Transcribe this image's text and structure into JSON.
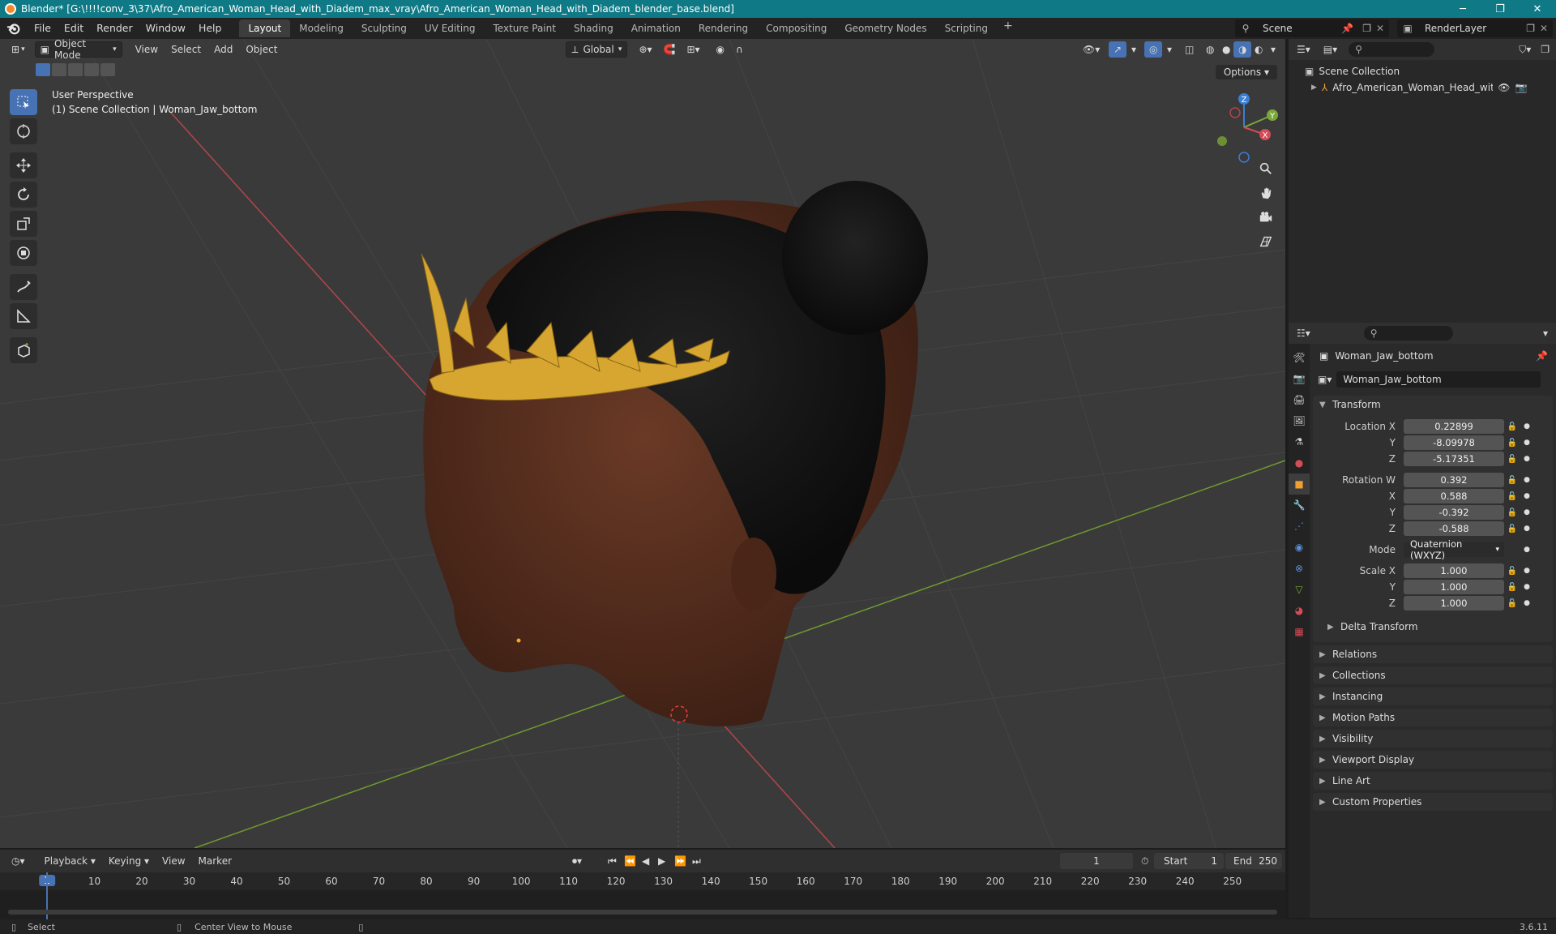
{
  "titlebar": {
    "title": "Blender* [G:\\!!!!conv_3\\37\\Afro_American_Woman_Head_with_Diadem_max_vray\\Afro_American_Woman_Head_with_Diadem_blender_base.blend]",
    "minimize": "─",
    "maximize": "❐",
    "close": "✕"
  },
  "menu": {
    "file": "File",
    "edit": "Edit",
    "render": "Render",
    "window": "Window",
    "help": "Help"
  },
  "workspaces": [
    "Layout",
    "Modeling",
    "Sculpting",
    "UV Editing",
    "Texture Paint",
    "Shading",
    "Animation",
    "Rendering",
    "Compositing",
    "Geometry Nodes",
    "Scripting"
  ],
  "workspace_add": "+",
  "scene": {
    "name": "Scene",
    "render_layer": "RenderLayer"
  },
  "viewport": {
    "mode": "Object Mode",
    "menus": {
      "view": "View",
      "select": "Select",
      "add": "Add",
      "object": "Object"
    },
    "transform_orientation": "Global",
    "options": "Options",
    "info_line1": "User Perspective",
    "info_line2": "(1) Scene Collection | Woman_Jaw_bottom",
    "gizmo": {
      "x": "X",
      "y": "Y",
      "z": "Z"
    }
  },
  "outliner": {
    "root": "Scene Collection",
    "items": [
      {
        "label": "Afro_American_Woman_Head_with_Dia"
      }
    ]
  },
  "properties": {
    "object_name": "Woman_Jaw_bottom",
    "data_name": "Woman_Jaw_bottom",
    "transform_title": "Transform",
    "location": {
      "label_x": "Location X",
      "label_y": "Y",
      "label_z": "Z",
      "x": "0.22899",
      "y": "-8.09978",
      "z": "-5.17351"
    },
    "rotation": {
      "label_w": "Rotation W",
      "label_x": "X",
      "label_y": "Y",
      "label_z": "Z",
      "w": "0.392",
      "x": "0.588",
      "y": "-0.392",
      "z": "-0.588"
    },
    "mode_label": "Mode",
    "mode_value": "Quaternion (WXYZ)",
    "scale": {
      "label_x": "Scale X",
      "label_y": "Y",
      "label_z": "Z",
      "x": "1.000",
      "y": "1.000",
      "z": "1.000"
    },
    "delta_transform": "Delta Transform",
    "panels": [
      "Relations",
      "Collections",
      "Instancing",
      "Motion Paths",
      "Visibility",
      "Viewport Display",
      "Line Art",
      "Custom Properties"
    ]
  },
  "timeline": {
    "playback": "Playback",
    "keying": "Keying",
    "view": "View",
    "marker": "Marker",
    "current_frame": "1",
    "start_label": "Start",
    "start": "1",
    "end_label": "End",
    "end": "250",
    "ruler_current": "1",
    "ticks": [
      "10",
      "20",
      "30",
      "40",
      "50",
      "60",
      "70",
      "80",
      "90",
      "100",
      "110",
      "120",
      "130",
      "140",
      "150",
      "160",
      "170",
      "180",
      "190",
      "200",
      "210",
      "220",
      "230",
      "240",
      "250"
    ]
  },
  "statusbar": {
    "select": "Select",
    "center_view": "Center View to Mouse",
    "version": "3.6.11"
  },
  "colors": {
    "titlebar": "#0f7a86",
    "accent": "#4772b3",
    "x_axis": "#d44c55",
    "y_axis": "#7ba73a",
    "z_axis": "#3a7fd4",
    "diadem": "#d6a630",
    "skin": "#5a3020",
    "hair": "#141414"
  }
}
